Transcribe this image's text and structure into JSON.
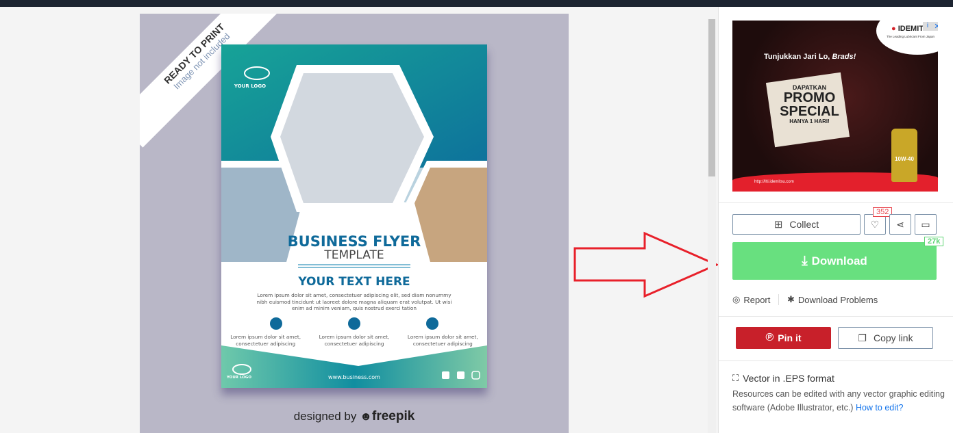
{
  "preview": {
    "ribbon_title": "READY TO PRINT",
    "ribbon_subtitle": "Image not included",
    "flyer": {
      "logo_text": "YOUR LOGO",
      "title": "BUSINESS FLYER",
      "subtitle": "TEMPLATE",
      "heading": "YOUR TEXT HERE",
      "body_lines": [
        "Lorem ipsum dolor sit amet, consectetuer adipiscing elit, sed diam nonummy",
        "nibh euismod tincidunt ut laoreet dolore magna aliquam erat volutpat. Ut wisi",
        "enim ad minim veniam, quis nostrud exerci tation"
      ],
      "features": [
        {
          "line1": "Lorem ipsum dolor sit amet,",
          "line2": "consectetuer adipiscing"
        },
        {
          "line1": "Lorem ipsum dolor sit amet,",
          "line2": "consectetuer adipiscing"
        },
        {
          "line1": "Lorem ipsum dolor sit amet,",
          "line2": "consectetuer adipiscing"
        }
      ],
      "footer_logo": "YOUR LOGO",
      "website": "www.business.com",
      "colors": {
        "teal": "#1a9e9a",
        "blue": "#0f6a9a",
        "mint": "#7fcaa8"
      }
    },
    "designed_by": "designed by",
    "brand": "freepik"
  },
  "ad": {
    "brand": "IDEMITSU",
    "brand_tagline": "The Leading Lubricant From Japan",
    "headline": "Tunjukkan Jari Lo, ",
    "headline_em": "Brads!",
    "promo_top": "DAPATKAN",
    "promo_main1": "PROMO",
    "promo_main2": "SPECIAL",
    "promo_bottom": "HANYA 1 HARI!",
    "product": "10W-40",
    "url": "http://llti.idemitsu.com"
  },
  "actions": {
    "collect_label": "Collect",
    "likes_count": "352",
    "download_label": "Download",
    "download_count": "27k",
    "report_label": "Report",
    "problems_label": "Download Problems",
    "pin_label": "Pin it",
    "copy_label": "Copy link"
  },
  "info": {
    "title": "Vector in .EPS format",
    "description": "Resources can be edited with any vector graphic editing software (Adobe Illustrator, etc.) ",
    "link": "How to edit?"
  },
  "colors": {
    "download": "#68e07f",
    "pinterest": "#c8202a",
    "annotation_arrow": "#e8202a",
    "link": "#1273eb"
  }
}
